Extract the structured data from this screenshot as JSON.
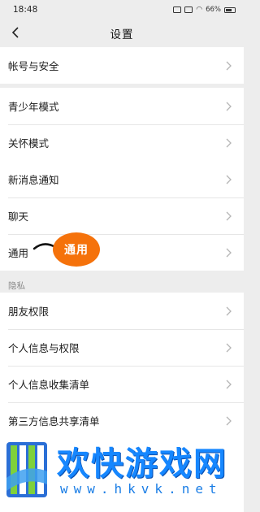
{
  "status_bar": {
    "time": "18:48",
    "battery": "66%"
  },
  "nav": {
    "title": "设置",
    "back_icon": "back-arrow-icon"
  },
  "groups": [
    {
      "items": [
        {
          "label": "帐号与安全"
        }
      ]
    },
    {
      "items": [
        {
          "label": "青少年模式"
        },
        {
          "label": "关怀模式"
        }
      ]
    },
    {
      "items": [
        {
          "label": "新消息通知"
        },
        {
          "label": "聊天"
        },
        {
          "label": "通用"
        }
      ]
    },
    {
      "section_label": "隐私",
      "items": [
        {
          "label": "朋友权限"
        },
        {
          "label": "个人信息与权限"
        },
        {
          "label": "个人信息收集清单"
        },
        {
          "label": "第三方信息共享清单"
        }
      ]
    }
  ],
  "annotation": {
    "text": "通用",
    "color": "#f5720b"
  },
  "watermark": {
    "title": "欢快游戏网",
    "url": "www.hkvk.net",
    "color": "#1687ff"
  }
}
